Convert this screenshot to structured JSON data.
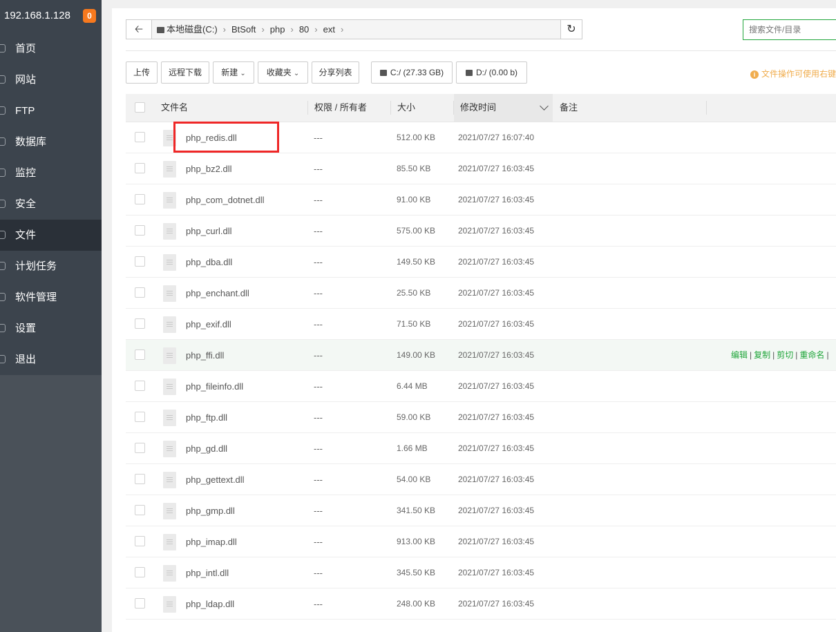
{
  "sidebar": {
    "server_ip": "192.168.1.128",
    "badge_count": "0",
    "items": [
      {
        "label": "首页",
        "icon": "home-icon"
      },
      {
        "label": "网站",
        "icon": "globe-icon"
      },
      {
        "label": "FTP",
        "icon": "ftp-icon"
      },
      {
        "label": "数据库",
        "icon": "database-icon"
      },
      {
        "label": "监控",
        "icon": "monitor-icon"
      },
      {
        "label": "安全",
        "icon": "shield-icon"
      },
      {
        "label": "文件",
        "icon": "folder-icon",
        "active": true
      },
      {
        "label": "计划任务",
        "icon": "clock-icon"
      },
      {
        "label": "软件管理",
        "icon": "apps-icon"
      },
      {
        "label": "设置",
        "icon": "gear-icon"
      },
      {
        "label": "退出",
        "icon": "logout-icon"
      }
    ]
  },
  "path": {
    "crumbs": [
      "本地磁盘(C:)",
      "BtSoft",
      "php",
      "80",
      "ext"
    ]
  },
  "search": {
    "placeholder": "搜索文件/目录"
  },
  "toolbar": {
    "upload": "上传",
    "remote_download": "远程下载",
    "new": "新建",
    "favorites": "收藏夹",
    "share_list": "分享列表",
    "disk_c": "C:/ (27.33 GB)",
    "disk_d": "D:/ (0.00 b)"
  },
  "tip": "文件操作可使用右键",
  "table": {
    "headers": {
      "name": "文件名",
      "perm": "权限 / 所有者",
      "size": "大小",
      "mtime": "修改时间",
      "note": "备注"
    },
    "rows": [
      {
        "name": "php_redis.dll",
        "perm": "---",
        "size": "512.00 KB",
        "mtime": "2021/07/27 16:07:40"
      },
      {
        "name": "php_bz2.dll",
        "perm": "---",
        "size": "85.50 KB",
        "mtime": "2021/07/27 16:03:45"
      },
      {
        "name": "php_com_dotnet.dll",
        "perm": "---",
        "size": "91.00 KB",
        "mtime": "2021/07/27 16:03:45"
      },
      {
        "name": "php_curl.dll",
        "perm": "---",
        "size": "575.00 KB",
        "mtime": "2021/07/27 16:03:45"
      },
      {
        "name": "php_dba.dll",
        "perm": "---",
        "size": "149.50 KB",
        "mtime": "2021/07/27 16:03:45"
      },
      {
        "name": "php_enchant.dll",
        "perm": "---",
        "size": "25.50 KB",
        "mtime": "2021/07/27 16:03:45"
      },
      {
        "name": "php_exif.dll",
        "perm": "---",
        "size": "71.50 KB",
        "mtime": "2021/07/27 16:03:45"
      },
      {
        "name": "php_ffi.dll",
        "perm": "---",
        "size": "149.00 KB",
        "mtime": "2021/07/27 16:03:45"
      },
      {
        "name": "php_fileinfo.dll",
        "perm": "---",
        "size": "6.44 MB",
        "mtime": "2021/07/27 16:03:45"
      },
      {
        "name": "php_ftp.dll",
        "perm": "---",
        "size": "59.00 KB",
        "mtime": "2021/07/27 16:03:45"
      },
      {
        "name": "php_gd.dll",
        "perm": "---",
        "size": "1.66 MB",
        "mtime": "2021/07/27 16:03:45"
      },
      {
        "name": "php_gettext.dll",
        "perm": "---",
        "size": "54.00 KB",
        "mtime": "2021/07/27 16:03:45"
      },
      {
        "name": "php_gmp.dll",
        "perm": "---",
        "size": "341.50 KB",
        "mtime": "2021/07/27 16:03:45"
      },
      {
        "name": "php_imap.dll",
        "perm": "---",
        "size": "913.00 KB",
        "mtime": "2021/07/27 16:03:45"
      },
      {
        "name": "php_intl.dll",
        "perm": "---",
        "size": "345.50 KB",
        "mtime": "2021/07/27 16:03:45"
      },
      {
        "name": "php_ldap.dll",
        "perm": "---",
        "size": "248.00 KB",
        "mtime": "2021/07/27 16:03:45"
      }
    ],
    "hover_ops": [
      "编辑",
      "复制",
      "剪切",
      "重命名"
    ]
  },
  "colors": {
    "accent": "#20a53a",
    "highlight": "#ef2727",
    "badge": "#f7791e",
    "sidebar": "#3c444d"
  }
}
